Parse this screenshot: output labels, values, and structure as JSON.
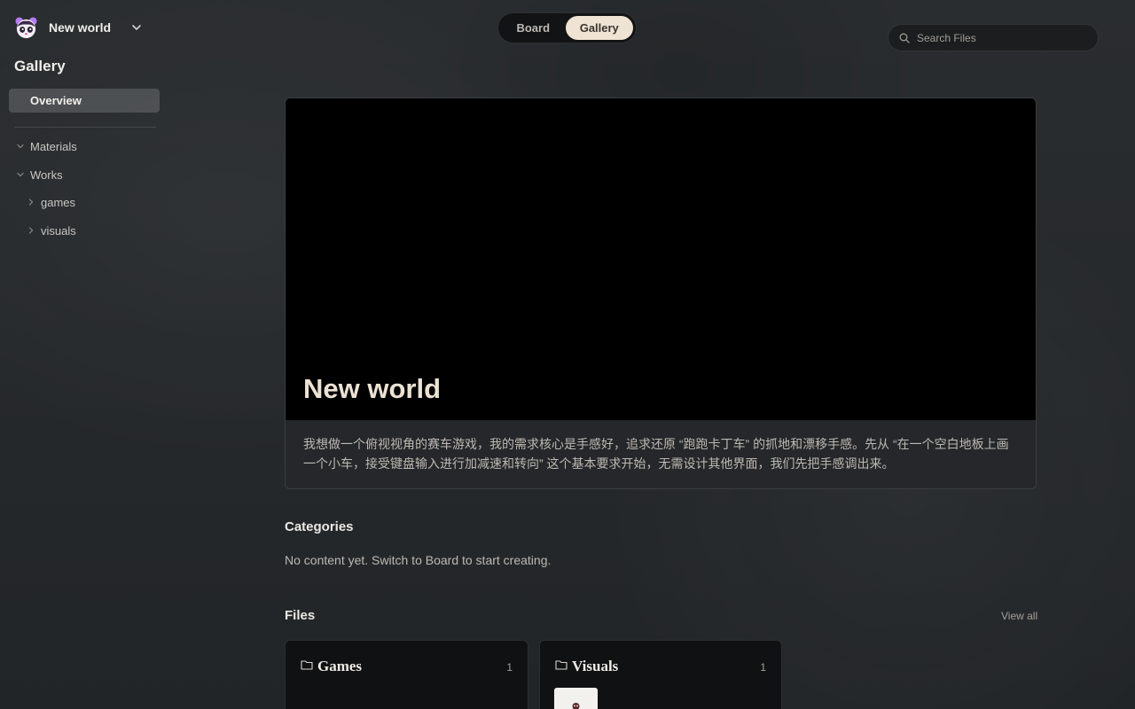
{
  "workspace": {
    "name": "New world",
    "logo_icon": "panda-logo-icon",
    "menu_icon": "chevron-down-icon"
  },
  "sidebar": {
    "title": "Gallery",
    "overview_label": "Overview",
    "tree": [
      {
        "label": "Materials",
        "expanded": true
      },
      {
        "label": "Works",
        "expanded": true
      },
      {
        "label": "games",
        "expanded": false
      },
      {
        "label": "visuals",
        "expanded": false
      }
    ]
  },
  "view_toggle": {
    "board_label": "Board",
    "gallery_label": "Gallery",
    "active": "Gallery"
  },
  "search": {
    "placeholder": "Search Files",
    "value": ""
  },
  "hero": {
    "title": "New world",
    "description": "我想做一个俯视视角的赛车游戏，我的需求核心是手感好，追求还原 “跑跑卡丁车” 的抓地和漂移手感。先从 “在一个空白地板上画一个小车，接受键盘输入进行加减速和转向” 这个基本要求开始，无需设计其他界面，我们先把手感调出来。"
  },
  "categories": {
    "title": "Categories",
    "empty_text": "No content yet. Switch to Board to start creating."
  },
  "files": {
    "title": "Files",
    "view_all_label": "View all",
    "items": [
      {
        "name": "Games",
        "count": "1",
        "icon": "folder-icon"
      },
      {
        "name": "Visuals",
        "count": "1",
        "icon": "folder-icon"
      }
    ]
  },
  "colors": {
    "accent": "#efe3d3",
    "background": "#25282b",
    "card": "#101112"
  }
}
